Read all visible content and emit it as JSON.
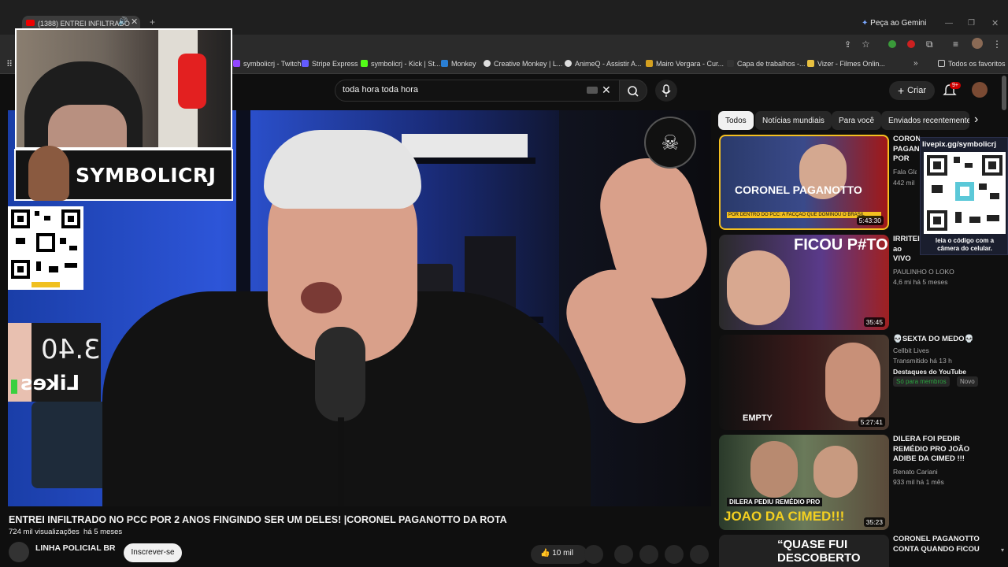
{
  "browser": {
    "tab_title": "(1388) ENTREI INFILTRADO",
    "gemini_label": "Peça ao Gemini",
    "bookmarks": [
      "symbolicrj - Twitch",
      "Stripe Express",
      "symbolicrj - Kick | St...",
      "Monkey",
      "Creative Monkey | L...",
      "AnimeQ - Assistir A...",
      "Mairo Vergara - Cur...",
      "Capa de trabalhos -...",
      "Vizer - Filmes Onlin...",
      "Todos os favoritos"
    ]
  },
  "youtube": {
    "search_value": "toda hora toda hora",
    "create_label": "Criar",
    "notif_badge": "9+"
  },
  "overlay": {
    "streamer_name": "SYMBOLICRJ",
    "likes_number": "3.40",
    "likes_label": "Likes",
    "qr_caption": "livepix.gg/symbolicrj",
    "qr_text": "leia o código com a câmera do celular."
  },
  "video": {
    "title": "ENTREI INFILTRADO NO PCC POR 2 ANOS FINGINDO SER UM DELES! |CORONEL PAGANOTTO DA ROTA",
    "views": "724 mil visualizações",
    "date": "há 5 meses",
    "channel": "LINHA POLICIAL BR",
    "subscribe": "Inscrever-se",
    "likes": "10 mil"
  },
  "chips": [
    "Todos",
    "Notícias mundiais",
    "Para você",
    "Enviados recentemente"
  ],
  "related": [
    {
      "title": "CORONEL PAGANOTTO POR DENTRO DO F4CÇÃO",
      "channel": "Fala Glauber",
      "meta": "442 mil",
      "duration": "5:43:30",
      "thumb_text": "CORONEL PAGANOTTO",
      "thumb_sub": "POR DENTRO DO PCC: A FACÇÃO QUE DOMINOU O BRASIL"
    },
    {
      "title": "IRRITEI ao VIVO (Paulinho o LOKO)",
      "channel": "PAULINHO O LOKO",
      "meta": "4,6 mi  há 5 meses",
      "duration": "35:45",
      "thumb_text": "FICOU P#TO"
    },
    {
      "title": "💀SEXTA DO MEDO💀",
      "channel": "Cellbit Lives",
      "meta": "Transmitido há 13 h",
      "extra": "Destaques do YouTube",
      "members": "Só para membros",
      "new": "Novo",
      "duration": "5:27:41",
      "thumb_text": "EMPTY"
    },
    {
      "title": "DILERA FOI PEDIR REMÉDIO PRO JOÃO ADIBE DA CIMED !!!",
      "channel": "Renato Cariani",
      "meta": "933 mil  há 1 mês",
      "duration": "35:23",
      "thumb_text": "JOAO DA CIMED!!!",
      "thumb_sub": "DILERA PEDIU REMÉDIO PRO"
    },
    {
      "title": "CORONEL PAGANOTTO CONTA QUANDO FICOU",
      "thumb_text": "“QUASE FUI DESCOBERTO"
    }
  ]
}
